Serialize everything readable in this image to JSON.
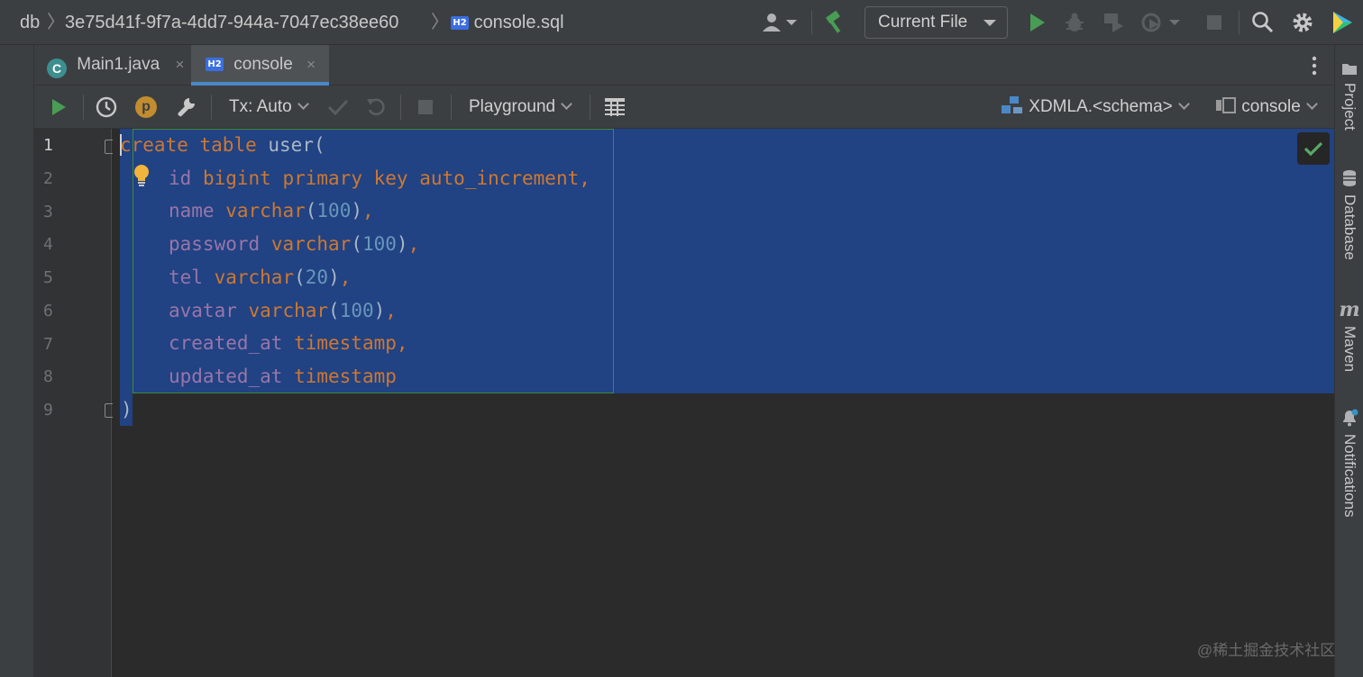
{
  "breadcrumbs": {
    "root": "db",
    "folder": "3e75d41f-9f7a-4dd7-944a-7047ec38ee60",
    "file_badge": "H2",
    "file": "console.sql"
  },
  "run_config": {
    "label": "Current File"
  },
  "tabs": [
    {
      "icon": "C",
      "label": "Main1.java",
      "close": "×"
    },
    {
      "icon": "H2",
      "label": "console",
      "close": "×"
    }
  ],
  "toolbar": {
    "tx_mode": "Tx: Auto",
    "playground": "Playground",
    "schema": "XDMLA.<schema>",
    "session": "console",
    "p_badge": "p"
  },
  "gutter": {
    "line_numbers": [
      "1",
      "2",
      "3",
      "4",
      "5",
      "6",
      "7",
      "8",
      "9"
    ]
  },
  "code": {
    "l1": {
      "kw1": "create",
      "kw2": "table",
      "name": "user",
      "open": "("
    },
    "l2": {
      "col": "id",
      "t1": "bigint",
      "t2": "primary",
      "t3": "key",
      "t4": "auto_increment",
      "comma": ","
    },
    "l3": {
      "col": "name",
      "type": "varchar",
      "open": "(",
      "num": "100",
      "close": ")",
      "comma": ","
    },
    "l4": {
      "col": "password",
      "type": "varchar",
      "open": "(",
      "num": "100",
      "close": ")",
      "comma": ","
    },
    "l5": {
      "col": "tel",
      "type": "varchar",
      "open": "(",
      "num": "20",
      "close": ")",
      "comma": ","
    },
    "l6": {
      "col": "avatar",
      "type": "varchar",
      "open": "(",
      "num": "100",
      "close": ")",
      "comma": ","
    },
    "l7": {
      "col": "created_at",
      "type": "timestamp",
      "comma": ","
    },
    "l8": {
      "col": "updated_at",
      "type": "timestamp"
    },
    "l9": {
      "close": ")"
    }
  },
  "right_panel": [
    "Project",
    "Database",
    "Maven",
    "Notifications"
  ],
  "maven_glyph": "m",
  "watermark": "@稀土掘金技术社区",
  "colors": {
    "selection": "#214283",
    "keyword": "#cc7832",
    "column": "#9876aa",
    "number": "#6897bb",
    "run_green": "#499c54",
    "accent_blue": "#4a88c7"
  }
}
